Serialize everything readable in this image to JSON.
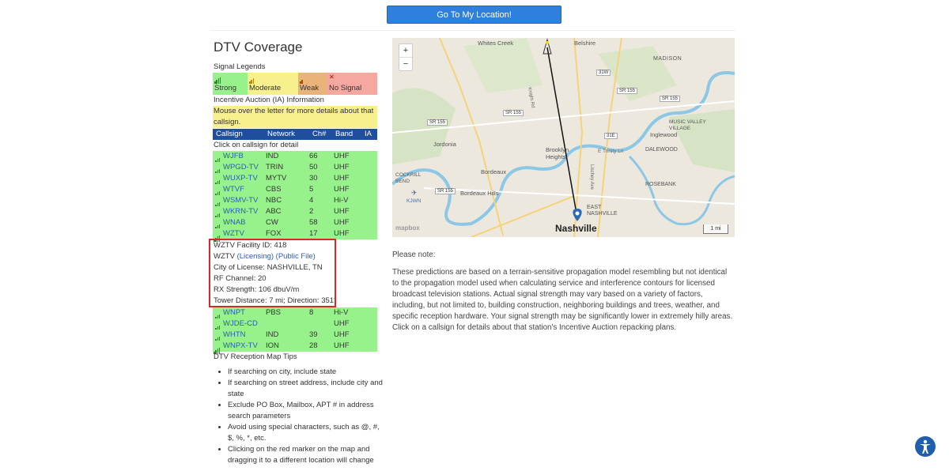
{
  "top_button": "Go To My Location!",
  "title": "DTV Coverage",
  "signal_legends_label": "Signal Legends",
  "legend": [
    {
      "label": "Strong",
      "color": "#98f28c"
    },
    {
      "label": "Moderate",
      "color": "#f8f08c"
    },
    {
      "label": "Weak",
      "color": "#e9b47a"
    },
    {
      "label": "No Signal",
      "color": "#f6a8a0"
    }
  ],
  "ia_label": "Incentive Auction (IA) Information",
  "ia_note": "Mouse over the letter for more details about that callsign.",
  "table_headers": [
    "Callsign",
    "Network",
    "Ch#",
    "Band",
    "IA"
  ],
  "click_hint": "Click on callsign for detail",
  "stations_top": [
    {
      "callsign": "WJFB",
      "network": "IND",
      "ch": "66",
      "band": "UHF"
    },
    {
      "callsign": "WPGD-TV",
      "network": "TRIN",
      "ch": "50",
      "band": "UHF"
    },
    {
      "callsign": "WUXP-TV",
      "network": "MYTV",
      "ch": "30",
      "band": "UHF"
    },
    {
      "callsign": "WTVF",
      "network": "CBS",
      "ch": "5",
      "band": "UHF"
    },
    {
      "callsign": "WSMV-TV",
      "network": "NBC",
      "ch": "4",
      "band": "Hi-V"
    },
    {
      "callsign": "WKRN-TV",
      "network": "ABC",
      "ch": "2",
      "band": "UHF"
    },
    {
      "callsign": "WNAB",
      "network": "CW",
      "ch": "58",
      "band": "UHF"
    },
    {
      "callsign": "WZTV",
      "network": "FOX",
      "ch": "17",
      "band": "UHF"
    }
  ],
  "detail": {
    "facility": "WZTV Facility ID: 418",
    "callsign": "WZTV",
    "licensing": "(Licensing)",
    "public_file": "(Public File)",
    "city": "City of License: NASHVILLE, TN",
    "rf": "RF Channel: 20",
    "rx": "RX Strength: 106 dbuV/m",
    "tower": "Tower Distance: 7 mi; Direction: 351°"
  },
  "stations_bottom": [
    {
      "callsign": "WNPT",
      "network": "PBS",
      "ch": "8",
      "band": "Hi-V"
    },
    {
      "callsign": "WJDE-CD",
      "network": "",
      "ch": "",
      "band": "UHF"
    },
    {
      "callsign": "WHTN",
      "network": "IND",
      "ch": "39",
      "band": "UHF"
    },
    {
      "callsign": "WNPX-TV",
      "network": "ION",
      "ch": "28",
      "band": "UHF"
    }
  ],
  "tips_label": "DTV Reception Map Tips",
  "tips": [
    "If searching on city, include state",
    "If searching on street address, include city and state",
    "Exclude PO Box, Mailbox, APT # in address search parameters",
    "Avoid using special characters, such as @, #, $, %, *, etc.",
    "Clicking on the red marker on the map and dragging it to a different location will change"
  ],
  "map": {
    "zoom_in": "+",
    "zoom_out": "−",
    "places": [
      "Whites Creek",
      "Belshire",
      "MADISON",
      "Jordonia",
      "Inglewood",
      "DALEWOOD",
      "Brooklyn Heights",
      "Bordeaux",
      "COCKRILL BEND",
      "Bordeaux Hills",
      "ROSEBANK",
      "MUSIC VALLEY VILLAGE",
      "EAST NASHVILLE",
      "Nashville",
      "KJWN"
    ],
    "roads": [
      "SR 155",
      "SR 155",
      "SR 155",
      "SR 155",
      "SR 155",
      "31W",
      "31E"
    ],
    "street_labels": [
      "Knight Rd",
      "E Trinity Ln",
      "Lischey Ave"
    ],
    "scale": "1 mi",
    "attribution": "mapbox"
  },
  "note_heading": "Please note:",
  "note_body": "These predictions are based on a terrain-sensitive propagation model resembling but not identical to the propagation model used when calculating service and interference contours for licensed broadcast television stations. Actual signal strength may vary based on a variety of factors, including, but not limited to, building construction, neighboring buildings and trees, weather, and specific reception hardware. Your signal strength may be significantly lower in extremely hilly areas. Click on a callsign for details about that station's Incentive Auction repacking plans."
}
